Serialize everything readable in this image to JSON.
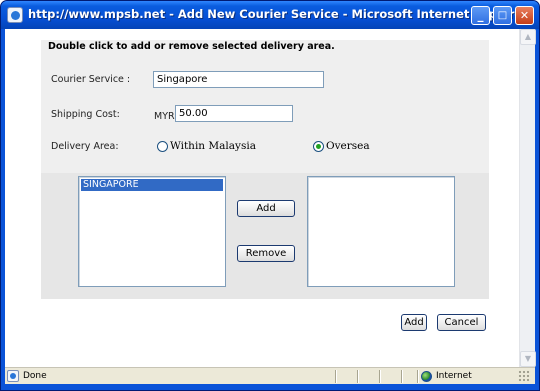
{
  "window": {
    "title": "http://www.mpsb.net - Add New Courier Service - Microsoft Internet Explorer",
    "minimize_glyph": "_",
    "maximize_glyph": "□",
    "close_glyph": "✕"
  },
  "form": {
    "instruction": "Double click to add or remove selected delivery area.",
    "courier_service_label": "Courier Service :",
    "courier_service_value": "Singapore",
    "shipping_cost_label": "Shipping Cost:",
    "currency": "MYR",
    "shipping_cost_value": "50.00",
    "delivery_area_label": "Delivery Area:",
    "delivery_area_options": [
      {
        "label": "Within Malaysia",
        "checked": false
      },
      {
        "label": "Oversea",
        "checked": true
      }
    ],
    "available_areas": [
      {
        "label": "SINGAPORE",
        "selected": true
      }
    ],
    "selected_areas": [],
    "add_area_button": "Add",
    "remove_area_button": "Remove",
    "submit_button": "Add",
    "cancel_button": "Cancel"
  },
  "statusbar": {
    "status_text": "Done",
    "zone_text": "Internet"
  },
  "icons": {
    "window_icon": "ie-page-icon",
    "zone_icon": "internet-globe-icon"
  },
  "colors": {
    "titlebar": "#0a5ddf",
    "selection": "#316ac5",
    "panel": "#efefef",
    "statusbar": "#ece9d8"
  }
}
